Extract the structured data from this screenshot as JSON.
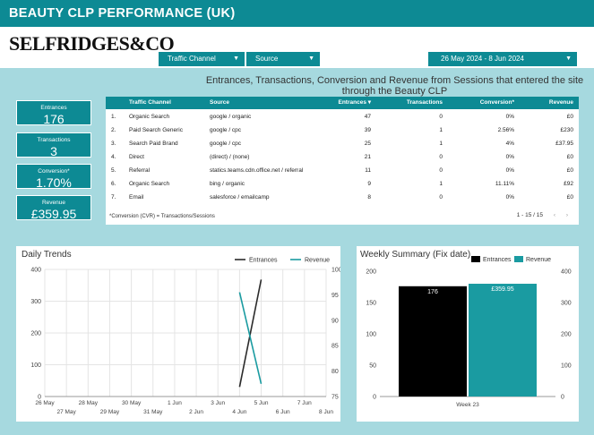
{
  "header": {
    "title": "BEAUTY CLP PERFORMANCE (UK)",
    "logo": "SELFRIDGES&CO"
  },
  "filters": {
    "traffic_channel": "Traffic Channel",
    "source": "Source",
    "date_range": "26 May 2024 - 8 Jun 2024"
  },
  "subtitle": "Entrances, Transactions, Conversion and Revenue from Sessions that entered the site through the Beauty CLP",
  "kpis": [
    {
      "label": "Entrances",
      "value": "176"
    },
    {
      "label": "Transactions",
      "value": "3"
    },
    {
      "label": "Conversion*",
      "value": "1.70%"
    },
    {
      "label": "Revenue",
      "value": "£359.95"
    }
  ],
  "table": {
    "columns": [
      "Traffic Channel",
      "Source",
      "Entrances ▾",
      "Transactions",
      "Conversion*",
      "Revenue"
    ],
    "rows": [
      [
        "1.",
        "Organic Search",
        "google / organic",
        "47",
        "0",
        "0%",
        "£0"
      ],
      [
        "2.",
        "Paid Search Generic",
        "google / cpc",
        "39",
        "1",
        "2.56%",
        "£230"
      ],
      [
        "3.",
        "Search Paid Brand",
        "google / cpc",
        "25",
        "1",
        "4%",
        "£37.95"
      ],
      [
        "4.",
        "Direct",
        "(direct) / (none)",
        "21",
        "0",
        "0%",
        "£0"
      ],
      [
        "5.",
        "Referral",
        "statics.teams.cdn.office.net / referral",
        "11",
        "0",
        "0%",
        "£0"
      ],
      [
        "6.",
        "Organic Search",
        "bing / organic",
        "9",
        "1",
        "11.11%",
        "£92"
      ],
      [
        "7.",
        "Email",
        "salesforce / emailcamp",
        "8",
        "0",
        "0%",
        "£0"
      ]
    ],
    "footnote": "*Conversion (CVR) = Transactions/Sessions",
    "pagination": "1 - 15 / 15"
  },
  "colors": {
    "accent": "#0d8a94",
    "page_bg": "#a6d9df",
    "entrances_series": "#2b2b2b",
    "revenue_series": "#1a9ba1"
  },
  "chart_data": [
    {
      "type": "line",
      "title": "Daily Trends",
      "x": [
        "26 May",
        "27 May",
        "28 May",
        "29 May",
        "30 May",
        "31 May",
        "1 Jun",
        "2 Jun",
        "3 Jun",
        "4 Jun",
        "5 Jun",
        "6 Jun",
        "7 Jun",
        "8 Jun"
      ],
      "series": [
        {
          "name": "Entrances",
          "axis": "left",
          "values": [
            null,
            null,
            null,
            null,
            null,
            null,
            null,
            null,
            null,
            30,
            368,
            null,
            null,
            null
          ]
        },
        {
          "name": "Revenue",
          "axis": "right",
          "values": [
            null,
            null,
            null,
            null,
            null,
            null,
            null,
            null,
            null,
            95.5,
            77.5,
            null,
            null,
            null
          ]
        }
      ],
      "ylim_left": [
        0,
        400
      ],
      "yticks_left": [
        0,
        100,
        200,
        300,
        400
      ],
      "ylim_right": [
        75,
        100
      ],
      "yticks_right": [
        75,
        80,
        85,
        90,
        95,
        100
      ],
      "legend": "top-right",
      "grid": true
    },
    {
      "type": "bar",
      "title": "Weekly Summary (Fix date)",
      "categories": [
        "Week 23"
      ],
      "series": [
        {
          "name": "Entrances",
          "axis": "left",
          "values": [
            176
          ],
          "label": "176"
        },
        {
          "name": "Revenue",
          "axis": "right",
          "values": [
            359.95
          ],
          "label": "£359.95"
        }
      ],
      "ylim_left": [
        0,
        200
      ],
      "yticks_left": [
        0,
        50,
        100,
        150,
        200
      ],
      "ylim_right": [
        0,
        400
      ],
      "yticks_right": [
        0,
        100,
        200,
        300,
        400
      ],
      "legend": "top",
      "grid": false
    }
  ]
}
